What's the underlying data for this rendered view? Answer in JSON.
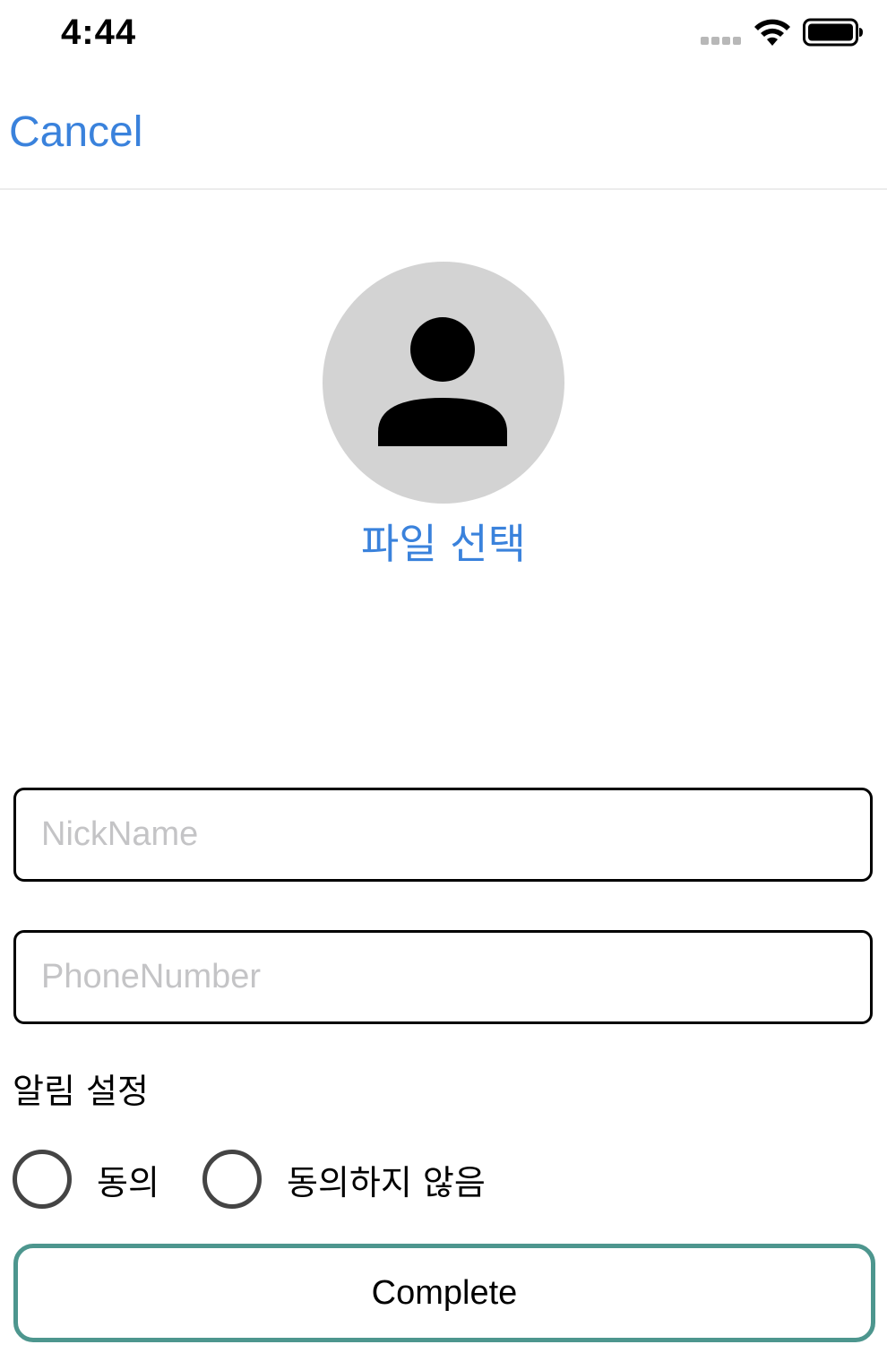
{
  "status_bar": {
    "time": "4:44"
  },
  "nav": {
    "cancel_label": "Cancel"
  },
  "profile": {
    "avatar_icon": "person-icon",
    "file_select_label": "파일 선택"
  },
  "form": {
    "nickname_placeholder": "NickName",
    "nickname_value": "",
    "phone_placeholder": "PhoneNumber",
    "phone_value": ""
  },
  "notification": {
    "label": "알림 설정",
    "options": [
      {
        "label": "동의",
        "selected": false
      },
      {
        "label": "동의하지 않음",
        "selected": false
      }
    ]
  },
  "complete_label": "Complete",
  "colors": {
    "accent": "#3a82dc",
    "button_border": "#4d968e",
    "avatar_bg": "#d3d3d3"
  }
}
